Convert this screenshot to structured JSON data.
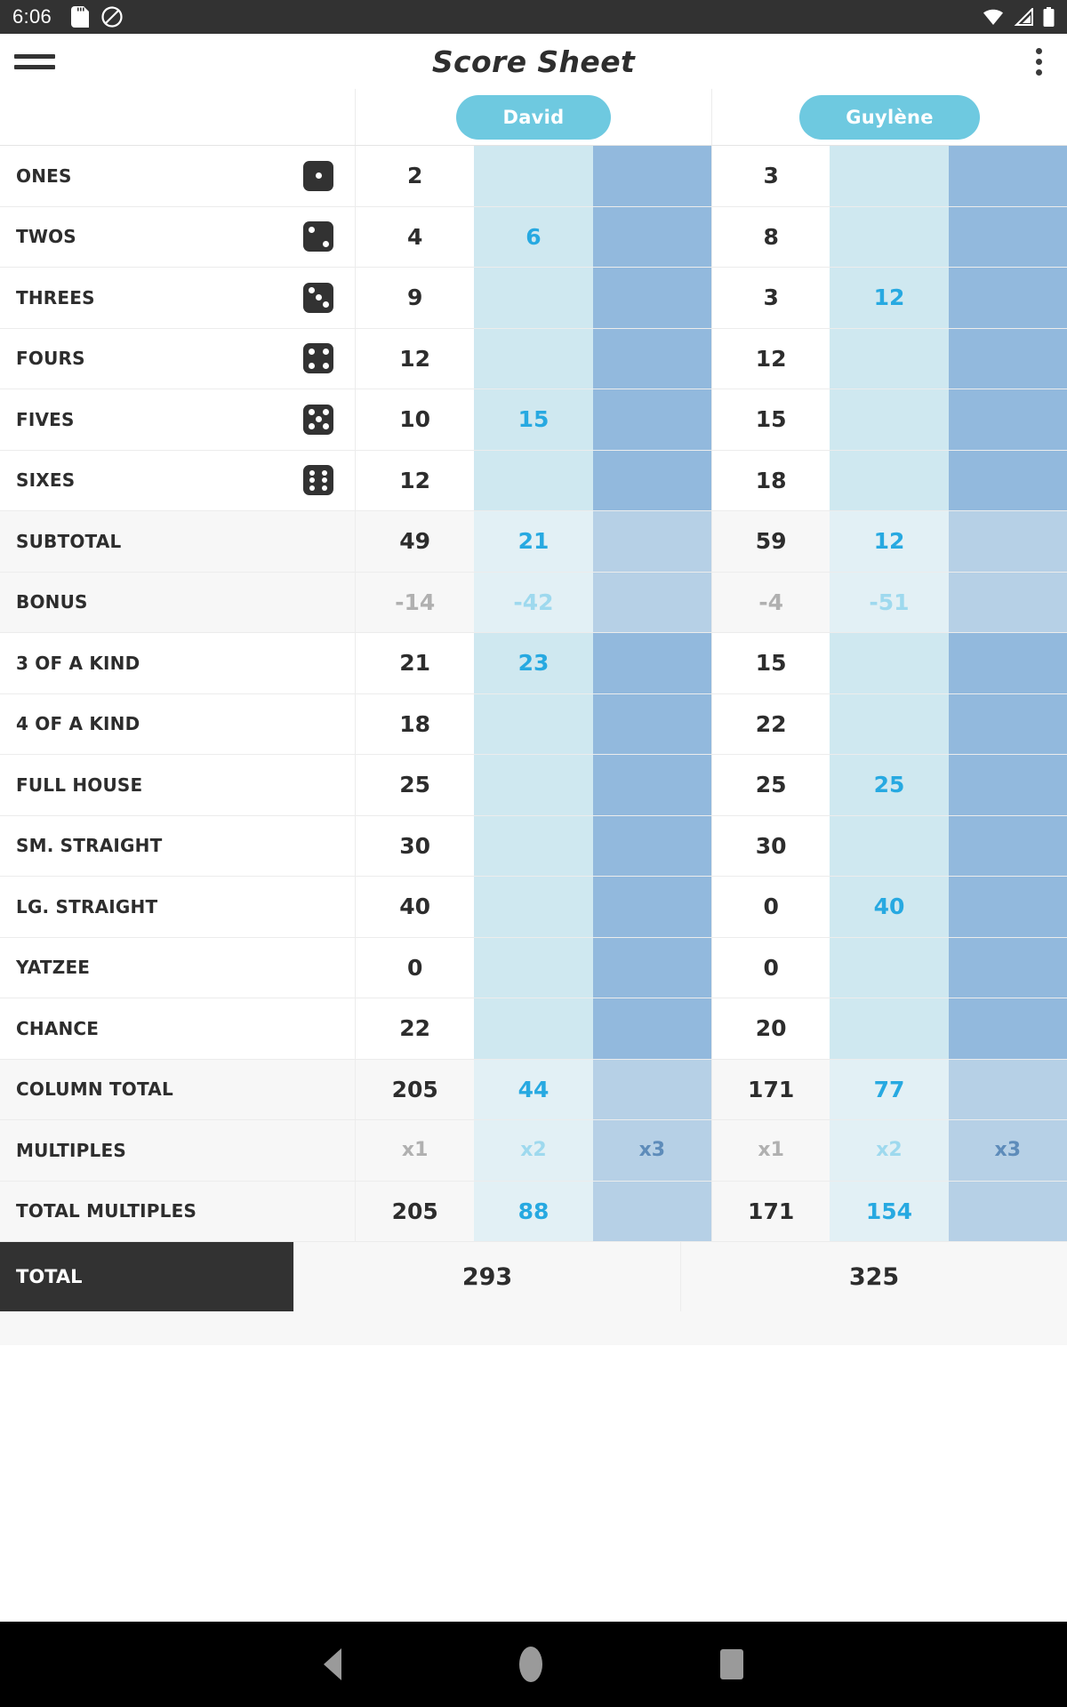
{
  "status_bar": {
    "time": "6:06",
    "icons": [
      "sd-card-icon",
      "do-not-disturb-icon",
      "wifi-icon",
      "signal-icon",
      "battery-icon"
    ]
  },
  "app_bar": {
    "menu_icon": "hamburger-menu-icon",
    "title": "Score Sheet",
    "overflow_icon": "overflow-menu-icon"
  },
  "colors": {
    "accent": "#27a9e1",
    "chip": "#6ec9e0",
    "col2": "#cfe8f0",
    "col3": "#92b9dd",
    "dark": "#323232"
  },
  "players": [
    {
      "name": "David"
    },
    {
      "name": "Guylène"
    }
  ],
  "rows": [
    {
      "label": "ONES",
      "die": 1,
      "shade": false,
      "cells": [
        "2",
        "",
        "",
        "3",
        "",
        ""
      ]
    },
    {
      "label": "TWOS",
      "die": 2,
      "shade": false,
      "cells": [
        "4",
        "6",
        "",
        "8",
        "",
        ""
      ]
    },
    {
      "label": "THREES",
      "die": 3,
      "shade": false,
      "cells": [
        "9",
        "",
        "",
        "3",
        "12",
        ""
      ]
    },
    {
      "label": "FOURS",
      "die": 4,
      "shade": false,
      "cells": [
        "12",
        "",
        "",
        "12",
        "",
        ""
      ]
    },
    {
      "label": "FIVES",
      "die": 5,
      "shade": false,
      "cells": [
        "10",
        "15",
        "",
        "15",
        "",
        ""
      ]
    },
    {
      "label": "SIXES",
      "die": 6,
      "shade": false,
      "cells": [
        "12",
        "",
        "",
        "18",
        "",
        ""
      ]
    },
    {
      "label": "SUBTOTAL",
      "die": 0,
      "shade": true,
      "cells": [
        "49",
        "21",
        "",
        "59",
        "12",
        ""
      ]
    },
    {
      "label": "BONUS",
      "die": 0,
      "shade": true,
      "muted": true,
      "cells": [
        "-14",
        "-42",
        "",
        "-4",
        "-51",
        ""
      ]
    },
    {
      "label": "3 OF A KIND",
      "die": 0,
      "shade": false,
      "cells": [
        "21",
        "23",
        "",
        "15",
        "",
        ""
      ]
    },
    {
      "label": "4 OF A KIND",
      "die": 0,
      "shade": false,
      "cells": [
        "18",
        "",
        "",
        "22",
        "",
        ""
      ]
    },
    {
      "label": "FULL HOUSE",
      "die": 0,
      "shade": false,
      "cells": [
        "25",
        "",
        "",
        "25",
        "25",
        ""
      ]
    },
    {
      "label": "SM. STRAIGHT",
      "die": 0,
      "shade": false,
      "cells": [
        "30",
        "",
        "",
        "30",
        "",
        ""
      ]
    },
    {
      "label": "LG. STRAIGHT",
      "die": 0,
      "shade": false,
      "cells": [
        "40",
        "",
        "",
        "0",
        "40",
        ""
      ]
    },
    {
      "label": "YATZEE",
      "die": 0,
      "shade": false,
      "cells": [
        "0",
        "",
        "",
        "0",
        "",
        ""
      ]
    },
    {
      "label": "CHANCE",
      "die": 0,
      "shade": false,
      "cells": [
        "22",
        "",
        "",
        "20",
        "",
        ""
      ]
    },
    {
      "label": "COLUMN TOTAL",
      "die": 0,
      "shade": true,
      "cells": [
        "205",
        "44",
        "",
        "171",
        "77",
        ""
      ]
    },
    {
      "label": "MULTIPLES",
      "die": 0,
      "shade": true,
      "multiplier": true,
      "cells": [
        "x1",
        "x2",
        "x3",
        "x1",
        "x2",
        "x3"
      ]
    },
    {
      "label": "TOTAL MULTIPLES",
      "die": 0,
      "shade": true,
      "cells": [
        "205",
        "88",
        "",
        "171",
        "154",
        ""
      ]
    }
  ],
  "total_row": {
    "label": "TOTAL",
    "values": [
      "293",
      "325"
    ]
  },
  "nav_bar": {
    "back": "back-triangle-icon",
    "home": "home-circle-icon",
    "recents": "recents-square-icon"
  }
}
